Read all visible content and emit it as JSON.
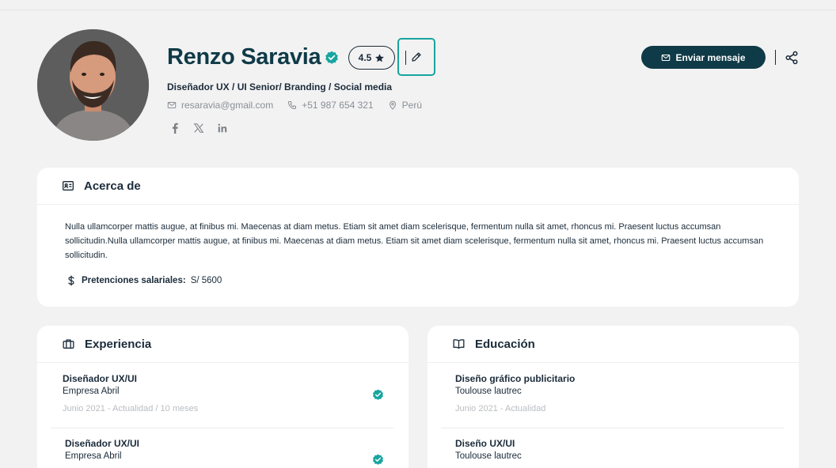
{
  "profile": {
    "name": "Renzo Saravia",
    "rating": "4.5",
    "role": "Diseñador UX / UI Senior/ Branding / Social media",
    "email": "resaravia@gmail.com",
    "phone": "+51 987 654 321",
    "location": "Perú"
  },
  "actions": {
    "send_message": "Enviar mensaje"
  },
  "about": {
    "title": "Acerca de",
    "text": "Nulla ullamcorper mattis augue, at finibus mi. Maecenas at diam metus. Etiam sit amet diam scelerisque, fermentum nulla sit amet, rhoncus mi. Praesent luctus accumsan sollicitudin.Nulla ullamcorper mattis augue, at finibus mi. Maecenas at diam metus. Etiam sit amet diam scelerisque, fermentum nulla sit amet, rhoncus mi. Praesent luctus accumsan sollicitudin.",
    "salary_label": "Pretenciones salariales:",
    "salary_value": "S/ 5600"
  },
  "experience": {
    "title": "Experiencia",
    "items": [
      {
        "title": "Diseñador UX/UI",
        "company": "Empresa Abril",
        "dates": "Junio 2021 - Actualidad / 10 meses"
      },
      {
        "title": "Diseñador UX/UI",
        "company": "Empresa Abril"
      }
    ]
  },
  "education": {
    "title": "Educación",
    "items": [
      {
        "title": "Diseño gráfico publicitario",
        "school": "Toulouse lautrec",
        "dates": "Junio 2021 - Actualidad"
      },
      {
        "title": "Diseño UX/UI",
        "school": "Toulouse lautrec"
      }
    ]
  },
  "colors": {
    "primary": "#0f3a47",
    "accent": "#18a5a0",
    "background": "#f2f2f2"
  }
}
